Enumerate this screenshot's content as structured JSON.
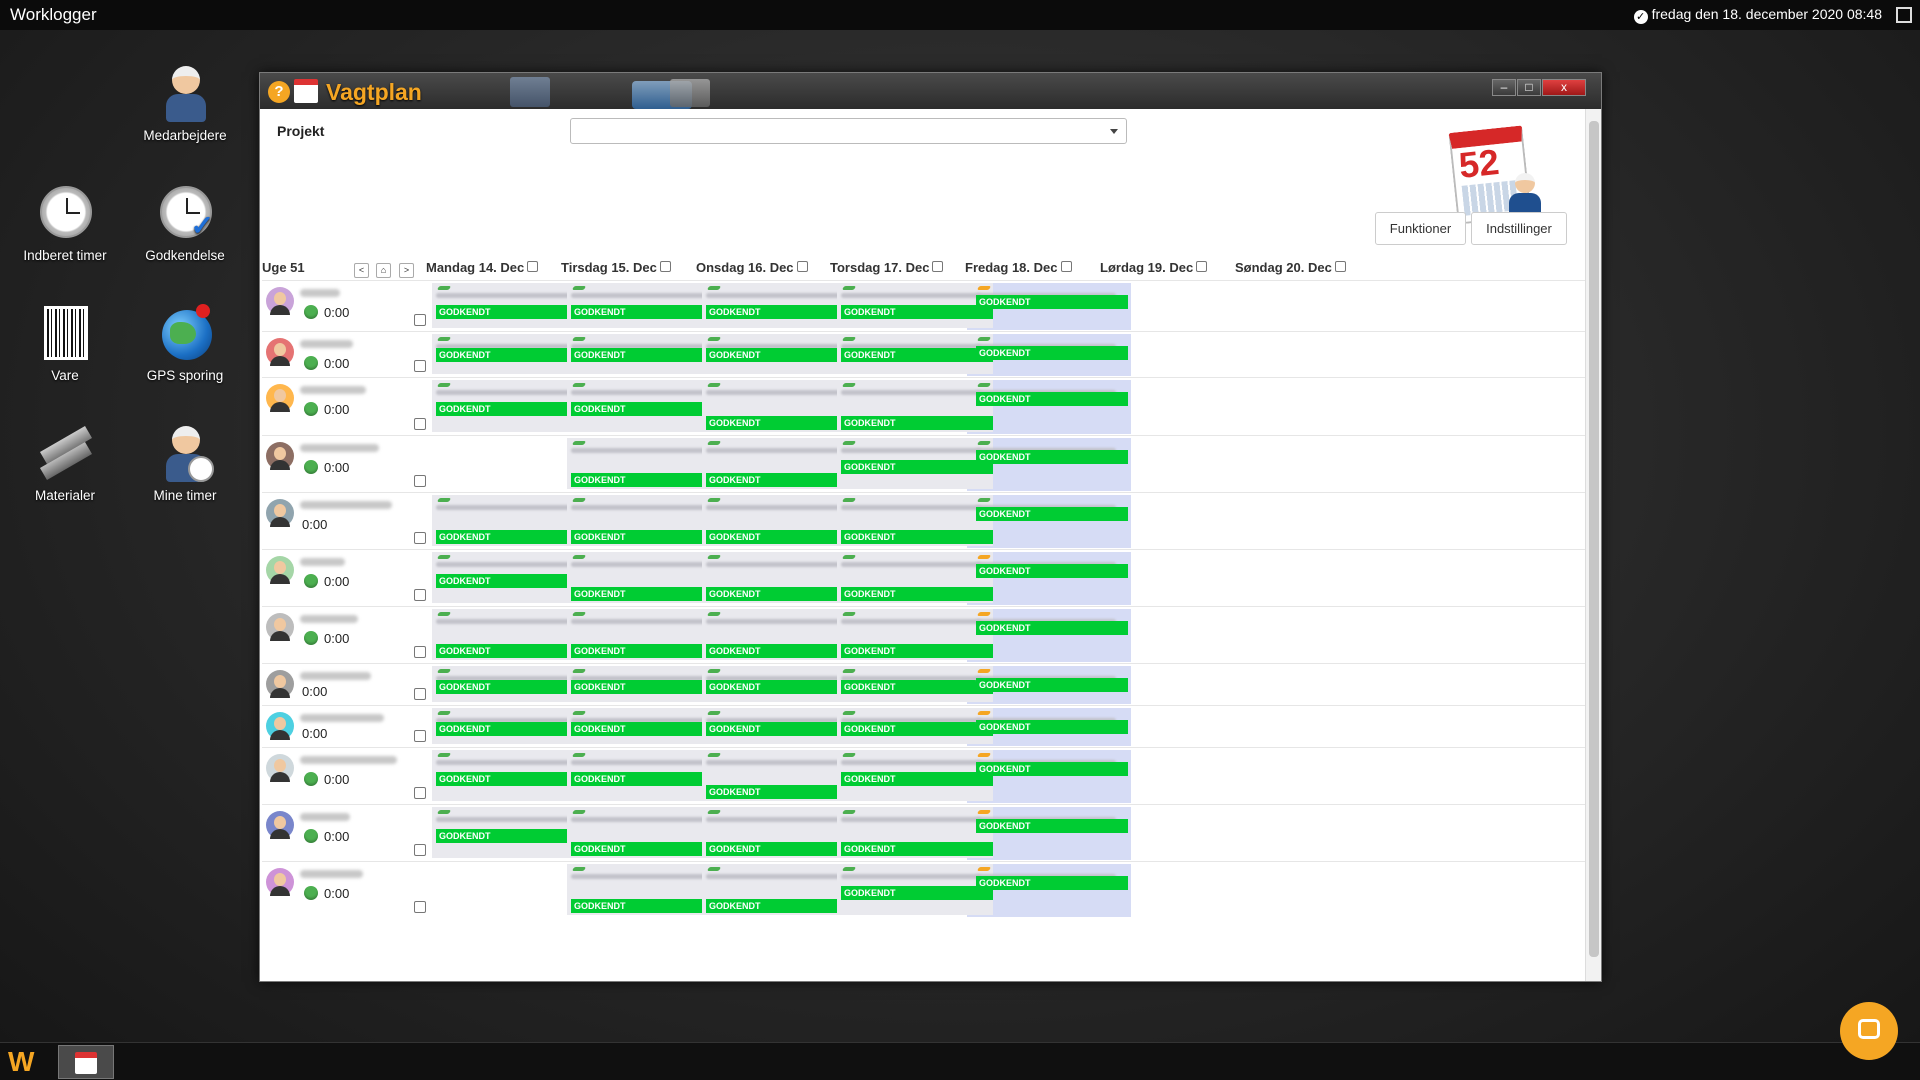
{
  "topbar": {
    "app_title": "Worklogger",
    "datetime": "fredag den 18. december 2020 08:48"
  },
  "desktop": {
    "icons": [
      {
        "label": "Medarbejdere",
        "icon": "worker-icon"
      },
      {
        "label": "Indberet timer",
        "icon": "clock-icon"
      },
      {
        "label": "Godkendelse",
        "icon": "clock-check-icon"
      },
      {
        "label": "Vare",
        "icon": "barcode-icon"
      },
      {
        "label": "GPS sporing",
        "icon": "globe-pin-icon"
      },
      {
        "label": "Materialer",
        "icon": "steel-beams-icon"
      },
      {
        "label": "Mine timer",
        "icon": "worker-clock-icon"
      }
    ]
  },
  "window": {
    "title": "Vagtplan",
    "projekt_label": "Projekt",
    "projekt_value": "",
    "calendar_number": "52",
    "buttons": {
      "funktioner": "Funktioner",
      "indstillinger": "Indstillinger"
    },
    "controls": {
      "minimize": "‒",
      "maximize": "□",
      "close": "x"
    }
  },
  "schedule": {
    "week_label": "Uge 51",
    "nav": {
      "prev": "<",
      "home": "⌂",
      "next": ">"
    },
    "days": [
      "Mandag 14. Dec",
      "Tirsdag 15. Dec",
      "Onsdag 16. Dec",
      "Torsdag 17. Dec",
      "Fredag 18. Dec",
      "Lørdag 19. Dec",
      "Søndag 20. Dec"
    ],
    "status_label": "GODKENDT",
    "employees": [
      {
        "hours": "0:00",
        "dot": true
      },
      {
        "hours": "0:00",
        "dot": true
      },
      {
        "hours": "0:00",
        "dot": true
      },
      {
        "hours": "0:00",
        "dot": true
      },
      {
        "hours": "0:00",
        "dot": false
      },
      {
        "hours": "0:00",
        "dot": true
      },
      {
        "hours": "0:00",
        "dot": true
      },
      {
        "hours": "0:00",
        "dot": false
      },
      {
        "hours": "0:00",
        "dot": false
      },
      {
        "hours": "0:00",
        "dot": true
      },
      {
        "hours": "0:00",
        "dot": true
      },
      {
        "hours": "0:00",
        "dot": true
      }
    ]
  },
  "colors": {
    "accent": "#f5a623",
    "approved": "#00cc33",
    "friday_highlight": "#d6dcf5"
  }
}
